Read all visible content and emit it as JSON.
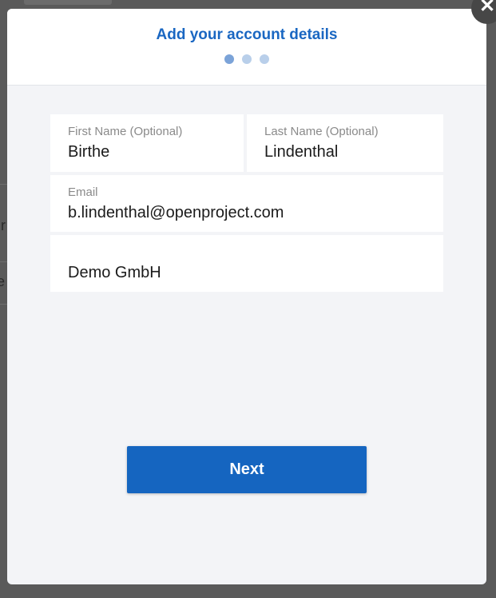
{
  "modal": {
    "title": "Add your account details",
    "steps": {
      "total": 3,
      "current": 1
    }
  },
  "form": {
    "first_name": {
      "label": "First Name (Optional)",
      "value": "Birthe"
    },
    "last_name": {
      "label": "Last Name (Optional)",
      "value": "Lindenthal"
    },
    "email": {
      "label": "Email",
      "value": "b.lindenthal@openproject.com"
    },
    "company": {
      "label": "",
      "value": "Demo GmbH"
    }
  },
  "actions": {
    "next_label": "Next"
  },
  "close": {
    "icon": "close-icon",
    "glyph": "✕"
  },
  "background": {
    "glyph_1": "ır",
    "glyph_2": "e"
  },
  "colors": {
    "accent": "#1565c0",
    "title": "#1a67c2",
    "dot_active": "#7ba3d8",
    "dot_inactive": "#b9cfea"
  }
}
